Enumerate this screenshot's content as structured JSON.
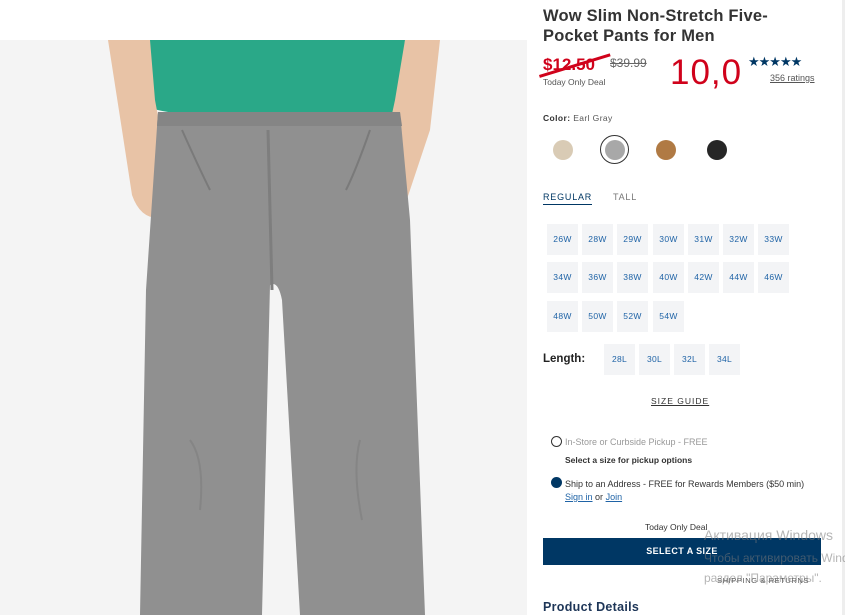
{
  "product": {
    "title": "Wow Slim Non-Stretch Five-Pocket Pants for Men",
    "sale_price": "$12.50",
    "original_price": "$39.99",
    "deal_label": "Today Only Deal",
    "overlay_number": "10,0",
    "stars": "★★★★★",
    "rating_value": 4.5,
    "ratings_count": "356 ratings",
    "image_alt": "Gray five-pocket pants worn with green t-shirt"
  },
  "color": {
    "label": "Color:",
    "selected": "Earl Gray",
    "swatches": [
      {
        "name": "khaki",
        "hex": "#d9cbb5"
      },
      {
        "name": "earl-gray",
        "hex": "#a8a8a8"
      },
      {
        "name": "brown",
        "hex": "#b07a44"
      },
      {
        "name": "black",
        "hex": "#262626"
      }
    ]
  },
  "fit_tabs": [
    "REGULAR",
    "TALL"
  ],
  "waist_sizes": [
    "26W",
    "28W",
    "29W",
    "30W",
    "31W",
    "32W",
    "33W",
    "34W",
    "36W",
    "38W",
    "40W",
    "42W",
    "44W",
    "46W",
    "48W",
    "50W",
    "52W",
    "54W"
  ],
  "length": {
    "label": "Length:",
    "sizes": [
      "28L",
      "30L",
      "32L",
      "34L"
    ]
  },
  "size_guide": "SIZE GUIDE",
  "fulfillment": {
    "pickup_label": "In-Store or Curbside Pickup - FREE",
    "pickup_hint": "Select a size for pickup options",
    "ship_label": "Ship to an Address - FREE for Rewards Members ($50 min)",
    "sign_in": "Sign in",
    "or": "or",
    "join": "Join"
  },
  "cta": {
    "deal": "Today Only Deal",
    "button": "SELECT A SIZE",
    "shipping_link": "SHIPPING & RETURNS"
  },
  "details_heading": "Product Details",
  "watermark": {
    "line1": "Активация Windows",
    "line2": "Чтобы активировать Windows,",
    "line3": "раздел \"Параметры\"."
  },
  "colors": {
    "accent": "#003764",
    "sale": "#d0021b",
    "link": "#1f63a6"
  }
}
